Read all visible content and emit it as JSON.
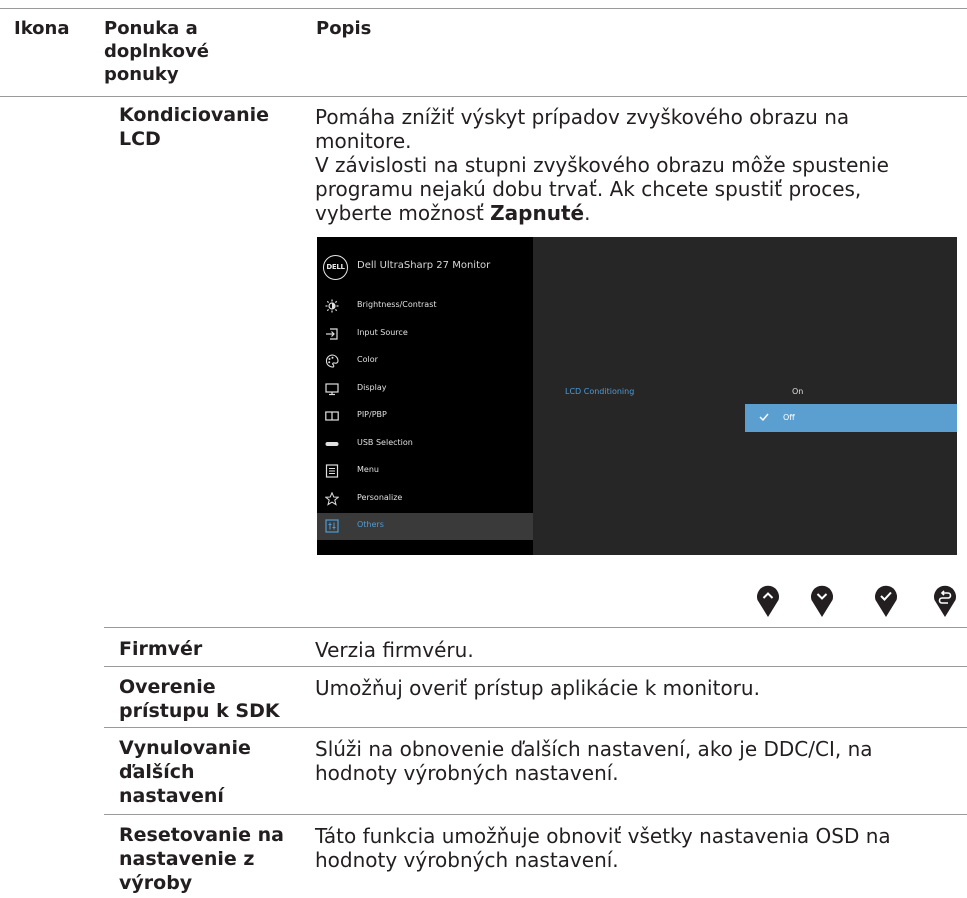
{
  "header": {
    "col1": "Ikona",
    "col2_line1": "Ponuka a",
    "col2_line2": "doplnkové",
    "col2_line3": "ponuky",
    "col3": "Popis"
  },
  "rows": {
    "lcd": {
      "label1": "Kondiciovanie",
      "label2": "LCD",
      "d1": "Pomáha znížiť výskyt prípadov zvyškového obrazu na",
      "d2": "monitore.",
      "d3": "V závislosti na stupni zvyškového obrazu môže spustenie",
      "d4": "programu nejakú dobu trvať. Ak chcete spustiť proces,",
      "d5a": "vyberte možnosť ",
      "d5b": "Zapnuté",
      "d5c": "."
    },
    "firmware": {
      "label1": "Firmvér",
      "d1": "Verzia firmvéru."
    },
    "sdk": {
      "label1": "Overenie",
      "label2": "prístupu k SDK",
      "d1": "Umožňuj overiť prístup aplikácie k monitoru."
    },
    "reset_other": {
      "label1": "Vynulovanie",
      "label2": "ďalších",
      "label3": "nastavení",
      "d1": "Slúži na obnovenie ďalších nastavení, ako je DDC/CI, na",
      "d2": "hodnoty výrobných nastavení."
    },
    "factory": {
      "label1": "Resetovanie na",
      "label2": "nastavenie z",
      "label3": "výroby",
      "d1": "Táto funkcia umožňuje obnoviť všetky nastavenia OSD na",
      "d2": "hodnoty výrobných nastavení."
    }
  },
  "osd": {
    "logo": "DELL",
    "title": "Dell UltraSharp 27 Monitor",
    "menu": [
      "Brightness/Contrast",
      "Input Source",
      "Color",
      "Display",
      "PIP/PBP",
      "USB Selection",
      "Menu",
      "Personalize",
      "Others"
    ],
    "option_label": "LCD Conditioning",
    "option_on": "On",
    "option_off": "Off"
  },
  "nav_buttons": [
    "up-arrow-icon",
    "down-arrow-icon",
    "check-icon",
    "back-icon"
  ]
}
